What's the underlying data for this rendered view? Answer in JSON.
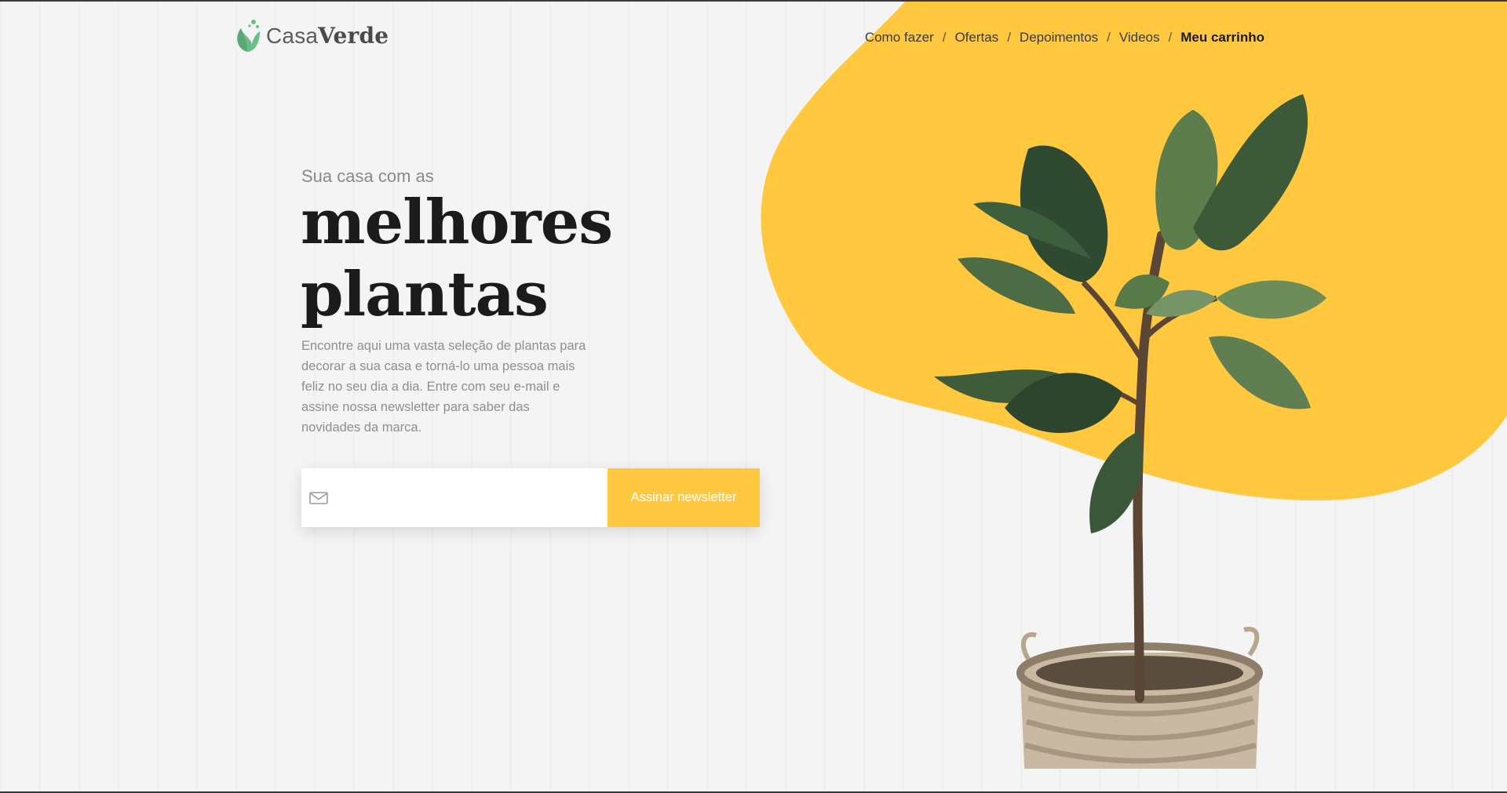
{
  "brand": {
    "name_light": "Casa",
    "name_bold": "Verde",
    "logo_icon": "leaf-icon",
    "accent_color": "#ffc83f",
    "logo_color": "#6cbf84"
  },
  "nav": {
    "items": [
      "Como fazer",
      "Ofertas",
      "Depoimentos",
      "Videos",
      "Meu carrinho"
    ],
    "separator": "/"
  },
  "hero": {
    "eyebrow": "Sua casa com as",
    "headline_line1": "melhores",
    "headline_line2": "plantas",
    "description": "Encontre aqui uma vasta seleção de plantas para decorar a sua casa e torná-lo uma pessoa mais feliz no seu dia a dia. Entre com seu e-mail e assine nossa newsletter para saber das novidades da marca."
  },
  "newsletter": {
    "email_value": "",
    "email_placeholder": "",
    "email_icon": "mail-icon",
    "button_label": "Assinar newsletter"
  }
}
